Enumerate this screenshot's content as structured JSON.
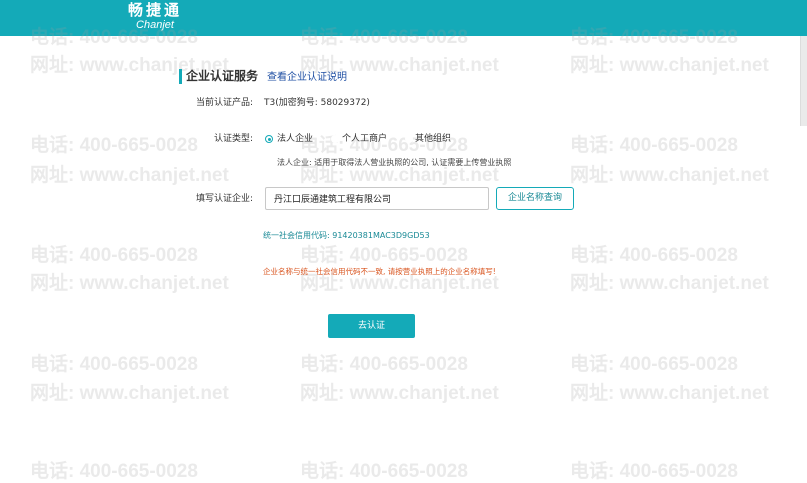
{
  "header": {
    "logo_cn": "畅捷通",
    "logo_en": "Chanjet"
  },
  "watermark": {
    "phone": "电话: 400-665-0028",
    "site": "网址: www.chanjet.net"
  },
  "section": {
    "title": "企业认证服务",
    "link": "查看企业认证说明"
  },
  "product": {
    "label": "当前认证产品:",
    "value": "T3(加密狗号: 58029372)"
  },
  "cert_type": {
    "label": "认证类型:",
    "options": [
      {
        "label": "法人企业",
        "selected": true
      },
      {
        "label": "个人工商户",
        "selected": false
      },
      {
        "label": "其他组织",
        "selected": false
      }
    ],
    "hint": "法人企业: 适用于取得法人营业执照的公司, 认证需要上传营业执照"
  },
  "company": {
    "label": "填写认证企业:",
    "value": "丹江口辰通建筑工程有限公司",
    "query_label": "企业名称查询"
  },
  "credit_code": "统一社会信用代码: 91420381MAC3D9GD53",
  "error": "企业名称与统一社会信用代码不一致, 请按营业执照上的企业名称填写!",
  "submit_label": "去认证",
  "colors": {
    "accent": "#14aab8",
    "link": "#1f4fa3",
    "error": "#d9541e"
  }
}
